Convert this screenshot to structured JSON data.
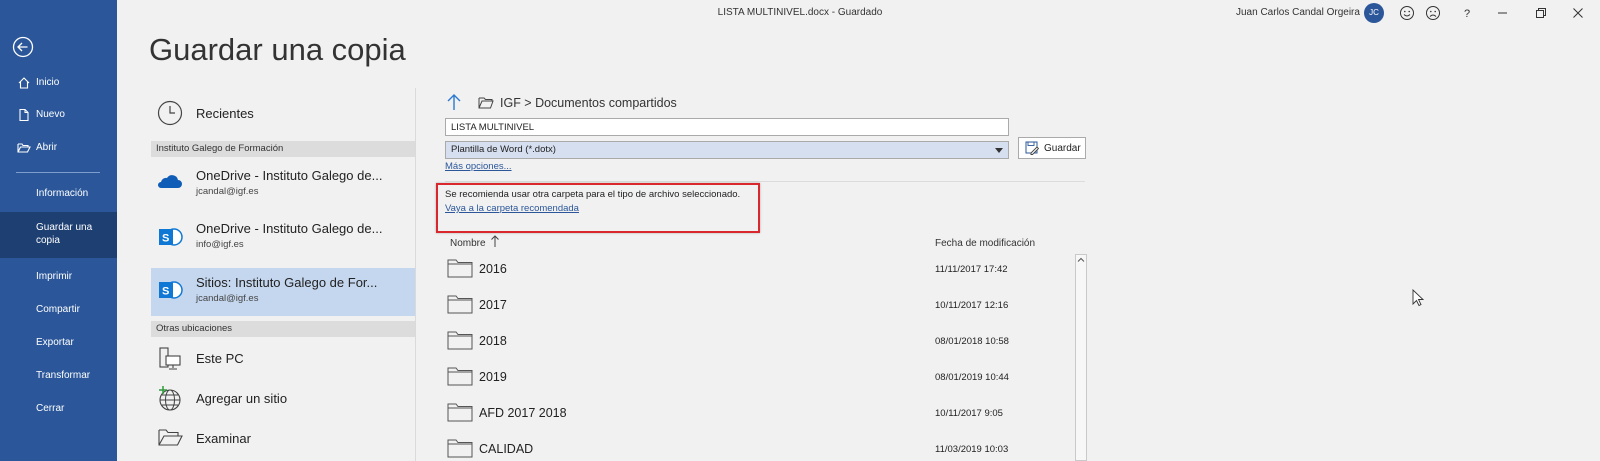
{
  "titlebar": {
    "document_title": "LISTA MULTINIVEL.docx  -  Guardado",
    "user_name": "Juan Carlos Candal Orgeira",
    "user_initials": "JC"
  },
  "nav": {
    "items": [
      {
        "label": "Inicio"
      },
      {
        "label": "Nuevo"
      },
      {
        "label": "Abrir"
      }
    ],
    "subitems": [
      {
        "label": "Información"
      },
      {
        "label": "Guardar una copia",
        "active": true
      },
      {
        "label": "Imprimir"
      },
      {
        "label": "Compartir"
      },
      {
        "label": "Exportar"
      },
      {
        "label": "Transformar"
      },
      {
        "label": "Cerrar"
      }
    ],
    "active_color": "#1e3f72",
    "background_color": "#2b579a"
  },
  "page": {
    "title": "Guardar una copia"
  },
  "locations": {
    "recent_label": "Recientes",
    "group1": "Instituto Galego de Formación",
    "items": [
      {
        "name": "OneDrive - Instituto Galego de...",
        "account": "jcandal@igf.es"
      },
      {
        "name": "OneDrive - Instituto Galego de...",
        "account": "info@igf.es"
      },
      {
        "name": "Sitios: Instituto Galego de For...",
        "account": "jcandal@igf.es",
        "selected": true
      }
    ],
    "group2": "Otras ubicaciones",
    "other": [
      {
        "label": "Este PC"
      },
      {
        "label": "Agregar un sitio"
      },
      {
        "label": "Examinar"
      }
    ]
  },
  "save": {
    "breadcrumb": "IGF  >  Documentos compartidos",
    "filename": "LISTA MULTINIVEL",
    "filetype": "Plantilla de Word (*.dotx)",
    "save_label": "Guardar",
    "more_options": "Más opciones...",
    "warning": "Se recomienda usar otra carpeta para el tipo de archivo seleccionado.",
    "warning_link": "Vaya a la carpeta recomendada"
  },
  "files": {
    "col_name": "Nombre",
    "col_date": "Fecha de modificación",
    "rows": [
      {
        "name": "2016",
        "date": "11/11/2017 17:42"
      },
      {
        "name": "2017",
        "date": "10/11/2017 12:16"
      },
      {
        "name": "2018",
        "date": "08/01/2018 10:58"
      },
      {
        "name": "2019",
        "date": "08/01/2019 10:44"
      },
      {
        "name": "AFD 2017 2018",
        "date": "10/11/2017 9:05"
      },
      {
        "name": "CALIDAD",
        "date": "11/03/2019 10:03"
      }
    ]
  }
}
